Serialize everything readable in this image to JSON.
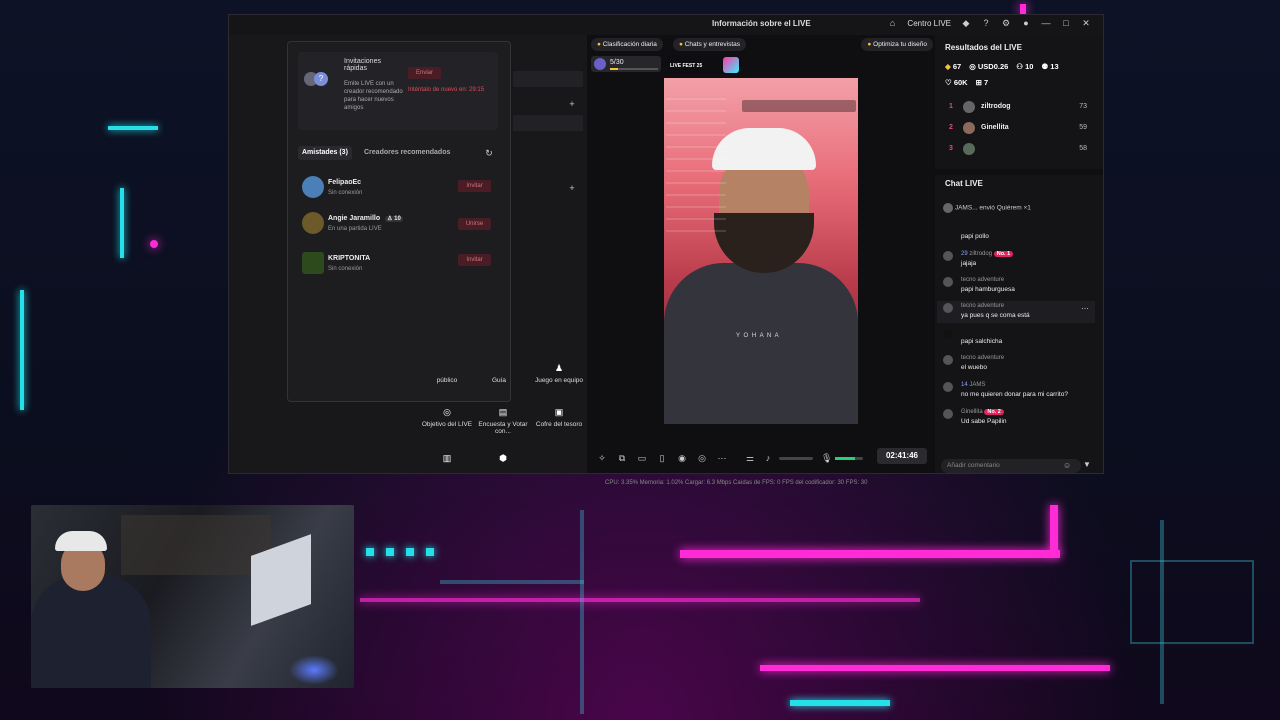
{
  "titlebar": {
    "center_title": "Información sobre el LIVE",
    "centro_live": "Centro LIVE"
  },
  "invite_card": {
    "title": "Invitaciones rápidas",
    "description": "Emite LIVE con un creador recomendado para hacer nuevos amigos",
    "send_label": "Enviar",
    "retry_text": "Inténtalo de nuevo en: 29:15"
  },
  "friends_tabs": {
    "friends": "Amistades (3)",
    "recommended": "Creadores recomendados"
  },
  "friends": [
    {
      "name": "FelipaoEc",
      "status": "Sin conexión",
      "action": "Invitar"
    },
    {
      "name": "Angie Jaramillo",
      "level": "10",
      "status": "En una partida LIVE",
      "action": "Unirse"
    },
    {
      "name": "KRIPTONITA",
      "status": "Sin conexión",
      "action": "Invitar"
    }
  ],
  "tools": [
    {
      "label": "público"
    },
    {
      "label": "Guía"
    },
    {
      "label": "Juego en equipo"
    },
    {
      "label": "Objetivo del LIVE"
    },
    {
      "label": "Encuesta y Votar con..."
    },
    {
      "label": "Cofre del tesoro"
    }
  ],
  "center": {
    "chip_daily": "Clasificación diaria",
    "chip_chats": "Chats y entrevistas",
    "chip_optimize": "Optimiza tu diseño",
    "goal_progress": "5/30",
    "fest_label": "LIVE FEST 25",
    "timer": "02:41:46",
    "status": "CPU: 3.35%    Memoria: 1.02%    Cargar: 6.3 Mbps    Caídas de FPS: 0    FPS del codificador: 30    FPS: 30"
  },
  "results": {
    "title": "Resultados del LIVE",
    "diamonds": "67",
    "usd": "USD0.26",
    "viewers": "10",
    "new_followers": "13",
    "likes": "60K",
    "gifts": "7",
    "ranking": [
      {
        "rank": "1",
        "name": "ziltrodog",
        "points": "73"
      },
      {
        "rank": "2",
        "name": "Ginellita",
        "points": "59"
      },
      {
        "rank": "3",
        "name": "",
        "points": "58"
      }
    ]
  },
  "chat": {
    "title": "Chat LIVE",
    "gift_banner": "JAMS... envió Quiérem ×1",
    "messages": [
      {
        "user": "",
        "text": "papi pollo"
      },
      {
        "user": "ziltrodog",
        "badge": "No. 1",
        "level": "29",
        "text": "jajaja"
      },
      {
        "user": "tecno adventure",
        "text": "papi hamburguesa"
      },
      {
        "user": "tecno adventure",
        "text": "ya pues q se coma está"
      },
      {
        "user": "",
        "text": "papi salchicha"
      },
      {
        "user": "tecno adventure",
        "text": "el wuebo"
      },
      {
        "user": "JAMS",
        "level": "14",
        "text": "no me quieren donar para mi carrito?"
      },
      {
        "user": "Ginellita",
        "badge": "No. 2",
        "text": "Ud sabe Papilin"
      }
    ],
    "comment_placeholder": "Añadir comentario"
  },
  "colors": {
    "neon_cyan": "#25e0e8",
    "neon_pink": "#ff2bd6",
    "accent_red": "#e0245e"
  }
}
